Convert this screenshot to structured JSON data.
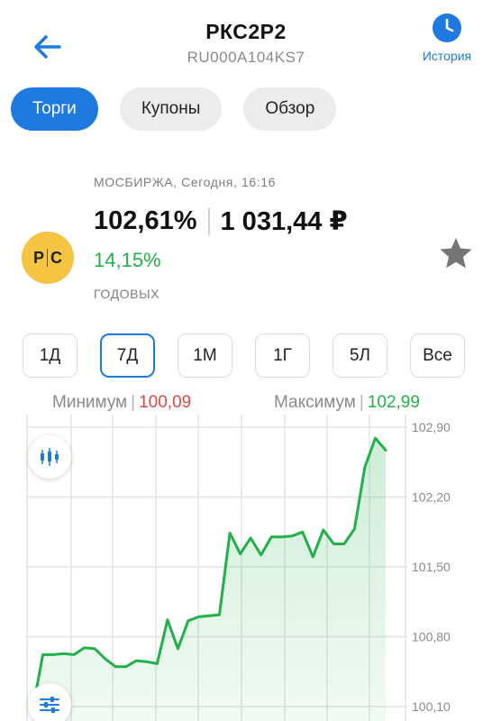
{
  "header": {
    "title": "РКС2Р2",
    "isin": "RU000A104KS7",
    "history_label": "История"
  },
  "tabs": [
    {
      "label": "Торги",
      "active": true
    },
    {
      "label": "Купоны",
      "active": false
    },
    {
      "label": "Обзор",
      "active": false
    }
  ],
  "quote": {
    "exchange": "МОСБИРЖА, Сегодня, 16:16",
    "price_pct": "102,61%",
    "price_rub": "1 031,44 ₽",
    "yield": "14,15%",
    "yield_label": "ГОДОВЫХ",
    "logo_left": "Р",
    "logo_right": "С"
  },
  "periods": [
    {
      "label": "1Д",
      "active": false
    },
    {
      "label": "7Д",
      "active": true
    },
    {
      "label": "1М",
      "active": false
    },
    {
      "label": "1Г",
      "active": false
    },
    {
      "label": "5Л",
      "active": false
    },
    {
      "label": "Все",
      "active": false
    }
  ],
  "range": {
    "min_label": "Минимум",
    "min_value": "100,09",
    "max_label": "Максимум",
    "max_value": "102,99"
  },
  "colors": {
    "accent": "#1f7ae0",
    "up": "#22b04b",
    "down": "#e24646",
    "logo_bg": "#f5c443"
  },
  "icons": {
    "back": "arrow-left-icon",
    "history": "clock-icon",
    "favorite": "star-icon",
    "candles": "candlestick-icon",
    "settings": "sliders-icon"
  },
  "chart_data": {
    "type": "area",
    "y_ticks": [
      "102,90",
      "102,20",
      "101,50",
      "100,80",
      "100,10"
    ],
    "y_tick_values": [
      102.9,
      102.2,
      101.5,
      100.8,
      100.1
    ],
    "ylim": [
      100.1,
      102.9
    ],
    "grid": true,
    "series": [
      {
        "values": [
          100.05,
          100.62,
          100.62,
          100.63,
          100.62,
          100.69,
          100.68,
          100.58,
          100.5,
          100.5,
          100.56,
          100.55,
          100.53,
          100.97,
          100.68,
          100.96,
          101.0,
          101.01,
          101.02,
          101.84,
          101.63,
          101.79,
          101.62,
          101.8,
          101.8,
          101.81,
          101.85,
          101.6,
          101.87,
          101.73,
          101.73,
          101.88,
          102.5,
          102.79,
          102.67
        ]
      }
    ]
  }
}
